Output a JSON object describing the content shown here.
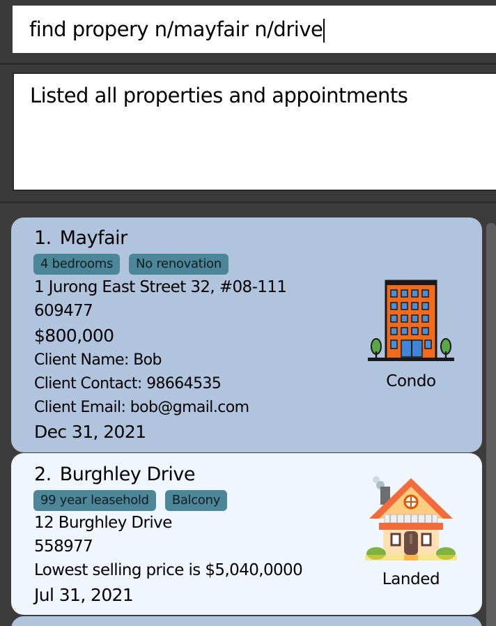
{
  "command": {
    "value": "find propery n/mayfair n/drive"
  },
  "result": {
    "message": "Listed all properties and appointments"
  },
  "properties": [
    {
      "index": "1.",
      "name": "Mayfair",
      "tags": [
        "4 bedrooms",
        "No renovation"
      ],
      "address": "1 Jurong East Street 32, #08-111",
      "postal": "609477",
      "price": "$800,000",
      "client_name": "Client Name: Bob",
      "client_contact": "Client Contact: 98664535",
      "client_email": "Client Email: bob@gmail.com",
      "date": "Dec 31, 2021",
      "type": "Condo",
      "icon": "condo-building-icon"
    },
    {
      "index": "2.",
      "name": "Burghley Drive",
      "tags": [
        "99 year leasehold",
        "Balcony"
      ],
      "address": "12 Burghley Drive",
      "postal": "558977",
      "price_note": "Lowest selling price is $5,040,0000",
      "date": "Jul 31, 2021",
      "type": "Landed",
      "icon": "landed-house-icon"
    }
  ],
  "colors": {
    "card_selected": "#b0c4de",
    "card_default": "#eff6fd",
    "tag": "#4b8799",
    "background": "#3c3c3c"
  }
}
